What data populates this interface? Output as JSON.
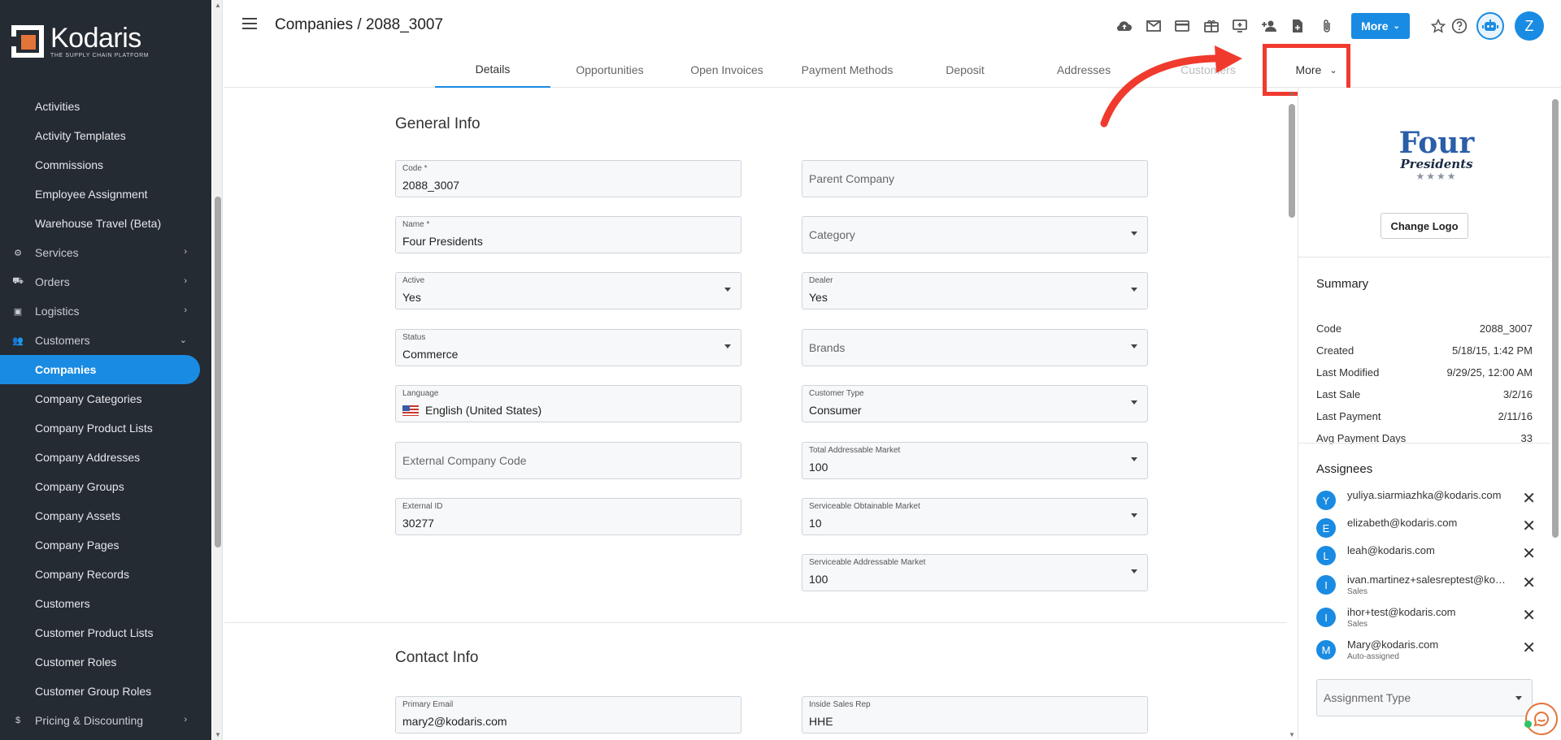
{
  "app": {
    "logo_name": "Kodaris",
    "logo_tagline": "THE SUPPLY CHAIN PLATFORM",
    "brand_color": "#1a8be2"
  },
  "sidebar": {
    "items": [
      {
        "label": "Activities",
        "type": "sub"
      },
      {
        "label": "Activity Templates",
        "type": "sub"
      },
      {
        "label": "Commissions",
        "type": "sub"
      },
      {
        "label": "Employee Assignment",
        "type": "sub"
      },
      {
        "label": "Warehouse Travel (Beta)",
        "type": "sub"
      },
      {
        "label": "Services",
        "type": "section",
        "icon": "gears-icon"
      },
      {
        "label": "Orders",
        "type": "section",
        "icon": "truck-icon"
      },
      {
        "label": "Logistics",
        "type": "section",
        "icon": "delivery-icon"
      },
      {
        "label": "Customers",
        "type": "section",
        "icon": "people-icon",
        "expanded": true
      },
      {
        "label": "Companies",
        "type": "sub",
        "active": true
      },
      {
        "label": "Company Categories",
        "type": "sub"
      },
      {
        "label": "Company Product Lists",
        "type": "sub"
      },
      {
        "label": "Company Addresses",
        "type": "sub"
      },
      {
        "label": "Company Groups",
        "type": "sub"
      },
      {
        "label": "Company Assets",
        "type": "sub"
      },
      {
        "label": "Company Pages",
        "type": "sub"
      },
      {
        "label": "Company Records",
        "type": "sub"
      },
      {
        "label": "Customers",
        "type": "sub"
      },
      {
        "label": "Customer Product Lists",
        "type": "sub"
      },
      {
        "label": "Customer Roles",
        "type": "sub"
      },
      {
        "label": "Customer Group Roles",
        "type": "sub"
      },
      {
        "label": "Pricing & Discounting",
        "type": "section",
        "icon": "dollar-icon"
      }
    ]
  },
  "header": {
    "breadcrumb": "Companies / 2088_3007",
    "more_label": "More",
    "avatar_initial": "Z"
  },
  "tabs": [
    {
      "label": "Details",
      "active": true
    },
    {
      "label": "Opportunities"
    },
    {
      "label": "Open Invoices"
    },
    {
      "label": "Payment Methods"
    },
    {
      "label": "Deposit"
    },
    {
      "label": "Addresses"
    },
    {
      "label": "Customers"
    }
  ],
  "tab_more_label": "More",
  "general_info": {
    "title": "General Info",
    "code": {
      "label": "Code *",
      "value": "2088_3007"
    },
    "parent_company": {
      "placeholder": "Parent Company"
    },
    "name": {
      "label": "Name *",
      "value": "Four Presidents"
    },
    "category": {
      "placeholder": "Category"
    },
    "active": {
      "label": "Active",
      "value": "Yes"
    },
    "dealer": {
      "label": "Dealer",
      "value": "Yes"
    },
    "status": {
      "label": "Status",
      "value": "Commerce"
    },
    "brands": {
      "placeholder": "Brands"
    },
    "language": {
      "label": "Language",
      "value": "English (United States)"
    },
    "customer_type": {
      "label": "Customer Type",
      "value": "Consumer"
    },
    "external_company_code": {
      "placeholder": "External Company Code"
    },
    "tam": {
      "label": "Total Addressable Market",
      "value": "100"
    },
    "external_id": {
      "label": "External ID",
      "value": "30277"
    },
    "som": {
      "label": "Serviceable Obtainable Market",
      "value": "10"
    },
    "sam": {
      "label": "Serviceable Addressable Market",
      "value": "100"
    }
  },
  "contact_info": {
    "title": "Contact Info",
    "primary_email": {
      "label": "Primary Email",
      "value": "mary2@kodaris.com"
    },
    "inside_sales_rep": {
      "label": "Inside Sales Rep",
      "value": "HHE"
    }
  },
  "right_panel": {
    "brand_four": "Four",
    "brand_presidents": "Presidents",
    "brand_stars": "★★★★",
    "change_logo": "Change Logo",
    "summary_title": "Summary",
    "summary": [
      {
        "k": "Code",
        "v": "2088_3007"
      },
      {
        "k": "Created",
        "v": "5/18/15, 1:42 PM"
      },
      {
        "k": "Last Modified",
        "v": "9/29/25, 12:00 AM"
      },
      {
        "k": "Last Sale",
        "v": "3/2/16"
      },
      {
        "k": "Last Payment",
        "v": "2/11/16"
      },
      {
        "k": "Avg Payment Days",
        "v": "33"
      }
    ],
    "assignees_title": "Assignees",
    "assignees": [
      {
        "initial": "Y",
        "email": "yuliya.siarmiazhka@kodaris.com",
        "role": ""
      },
      {
        "initial": "E",
        "email": "elizabeth@kodaris.com",
        "role": ""
      },
      {
        "initial": "L",
        "email": "leah@kodaris.com",
        "role": ""
      },
      {
        "initial": "I",
        "email": "ivan.martinez+salesreptest@kodaris.com",
        "role": "Sales"
      },
      {
        "initial": "I",
        "email": "ihor+test@kodaris.com",
        "role": "Sales"
      },
      {
        "initial": "M",
        "email": "Mary@kodaris.com",
        "role": "Auto-assigned"
      }
    ],
    "assignment_type_placeholder": "Assignment Type"
  },
  "annotation": {
    "highlight_color": "#f03a2e"
  }
}
